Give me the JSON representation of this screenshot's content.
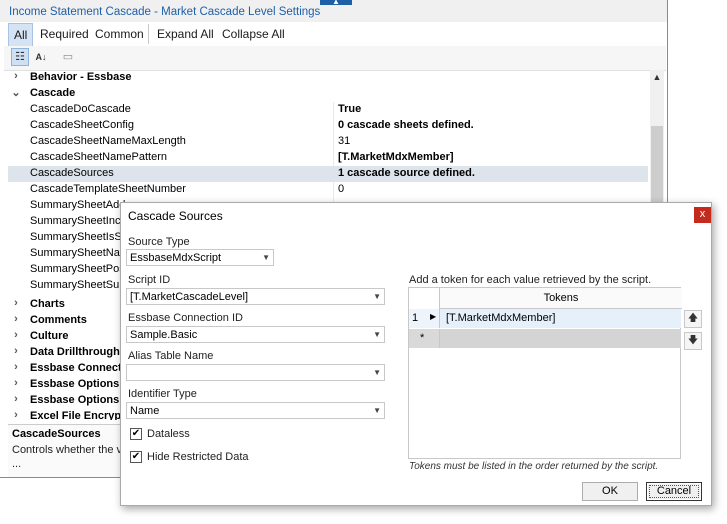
{
  "window": {
    "title": "Income Statement Cascade  - Market Cascade Level Settings"
  },
  "tabs": {
    "all": "All",
    "required": "Required",
    "common": "Common",
    "expand_all": "Expand All",
    "collapse_all": "Collapse All"
  },
  "toolbar": {
    "categorized_icon": "categorized-view-icon",
    "alpha_icon": "alphabetical-sort-icon",
    "pages_icon": "property-pages-icon"
  },
  "grid": {
    "behavior": "Behavior - Essbase",
    "cascade": "Cascade",
    "props": [
      {
        "name": "CascadeDoCascade",
        "value": "True",
        "bold": true
      },
      {
        "name": "CascadeSheetConfig",
        "value": "0 cascade sheets defined.",
        "bold": true
      },
      {
        "name": "CascadeSheetNameMaxLength",
        "value": "31",
        "bold": false
      },
      {
        "name": "CascadeSheetNamePattern",
        "value": "[T.MarketMdxMember]",
        "bold": true
      },
      {
        "name": "CascadeSources",
        "value": "1 cascade source defined.",
        "bold": true
      },
      {
        "name": "CascadeTemplateSheetNumber",
        "value": "0",
        "bold": false
      },
      {
        "name": "SummarySheetAdd",
        "value": ""
      },
      {
        "name": "SummarySheetInclu",
        "value": ""
      },
      {
        "name": "SummarySheetIsSum",
        "value": ""
      },
      {
        "name": "SummarySheetName",
        "value": ""
      },
      {
        "name": "SummarySheetPosit",
        "value": ""
      },
      {
        "name": "SummarySheetSumm",
        "value": ""
      }
    ],
    "categories_after": [
      "Charts",
      "Comments",
      "Culture",
      "Data Drillthrough",
      "Essbase Connection",
      "Essbase Options",
      "Essbase Options - D",
      "Excel File Encryption"
    ]
  },
  "description": {
    "title": "CascadeSources",
    "text": "Controls whether the vie",
    "more": "..."
  },
  "dialog": {
    "title": "Cascade Sources",
    "close": "x",
    "source_type_label": "Source Type",
    "source_type_value": "EssbaseMdxScript",
    "script_id_label": "Script ID",
    "script_id_value": "[T.MarketCascadeLevel]",
    "connection_label": "Essbase Connection ID",
    "connection_value": "Sample.Basic",
    "alias_label": "Alias Table Name",
    "alias_value": "",
    "identifier_label": "Identifier Type",
    "identifier_value": "Name",
    "dataless_label": "Dataless",
    "dataless_checked": true,
    "hide_restricted_label": "Hide Restricted Data",
    "hide_restricted_checked": true,
    "tokens_hint": "Add a token for each value retrieved by the script.",
    "tokens_header": "Tokens",
    "token_rows": [
      {
        "num": "1",
        "value": "[T.MarketMdxMember]"
      }
    ],
    "new_row_marker": "*",
    "tokens_note": "Tokens must be listed in the order returned by the script.",
    "ok": "OK",
    "cancel": "Cancel"
  }
}
